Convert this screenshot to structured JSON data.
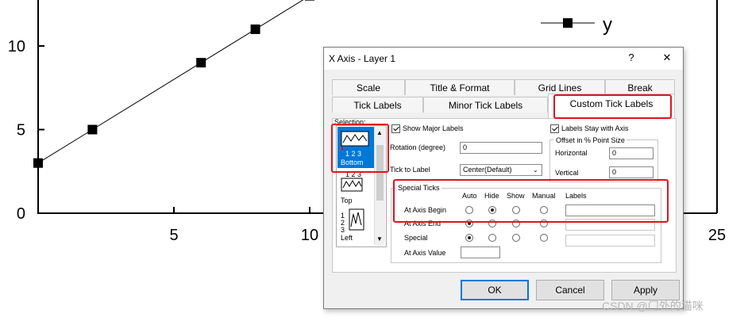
{
  "chart_data": {
    "type": "line",
    "x": [
      0,
      2,
      6,
      8,
      10
    ],
    "y": [
      3,
      5,
      9,
      11,
      13
    ],
    "xlim": [
      0,
      25
    ],
    "ylim": [
      0,
      15
    ],
    "xticks": [
      "5",
      "10",
      "25"
    ],
    "yticks": [
      "0",
      "5",
      "10"
    ],
    "legend": {
      "label": "y",
      "placement": "top-right"
    },
    "marker": "square",
    "colors": {
      "line": "#000000",
      "marker": "#000000"
    }
  },
  "dialog": {
    "title": "X Axis - Layer 1",
    "help": "?",
    "close": "✕",
    "tabs_row1": [
      "Scale",
      "Title & Format",
      "Grid Lines",
      "Break"
    ],
    "tabs_row2": [
      "Tick Labels",
      "Minor Tick Labels",
      "Custom Tick Labels"
    ],
    "selection": {
      "label": "Selection:",
      "items": [
        {
          "name": "Bottom",
          "nums": "1 2 3",
          "selected": true
        },
        {
          "name": "Top",
          "nums": "1 2 3",
          "selected": false
        },
        {
          "name": "Left",
          "nums": "1 2 3",
          "selected": false
        }
      ]
    },
    "show_major_labels": {
      "label": "Show Major Labels",
      "checked": true
    },
    "labels_stay_with_axis": {
      "label": "Labels Stay with Axis",
      "checked": true
    },
    "rotation": {
      "label": "Rotation (degree)",
      "value": "0"
    },
    "tick_to_label": {
      "label": "Tick to Label",
      "value": "Center(Default)"
    },
    "offset": {
      "title": "Offset in % Point Size",
      "horizontal_label": "Horizontal",
      "horizontal_value": "0",
      "vertical_label": "Vertical",
      "vertical_value": "0"
    },
    "special_ticks": {
      "title": "Special Ticks",
      "columns": [
        "Auto",
        "Hide",
        "Show",
        "Manual",
        "Labels"
      ],
      "rows": [
        {
          "label": "At Axis Begin",
          "selected": 1
        },
        {
          "label": "At Axis End",
          "selected": 0
        },
        {
          "label": "Special",
          "selected": 0
        }
      ],
      "at_axis_value_label": "At Axis Value"
    },
    "buttons": {
      "ok": "OK",
      "cancel": "Cancel",
      "apply": "Apply"
    }
  },
  "watermark": "CSDN @门外的猫咪"
}
